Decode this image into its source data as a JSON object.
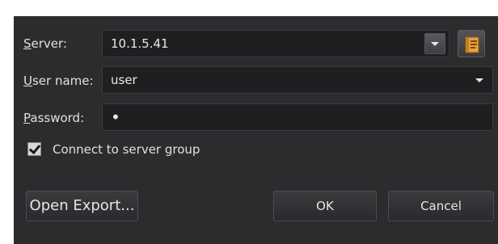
{
  "form": {
    "server": {
      "label_mnemonic": "S",
      "label_rest": "erver:",
      "value": "10.1.5.41"
    },
    "username": {
      "label_mnemonic": "U",
      "label_rest": "ser name:",
      "value": "user"
    },
    "password": {
      "label_mnemonic": "P",
      "label_rest": "assword:",
      "value": "•"
    },
    "server_group": {
      "label_pre": "Connect to server ",
      "label_mnemonic": "g",
      "label_post": "roup",
      "checked": true
    }
  },
  "buttons": {
    "open_export": "Open Export...",
    "ok": "OK",
    "cancel": "Cancel"
  },
  "icons": {
    "browse": "address-book-icon",
    "dropdown": "chevron-down-icon",
    "check": "checkmark-icon"
  }
}
